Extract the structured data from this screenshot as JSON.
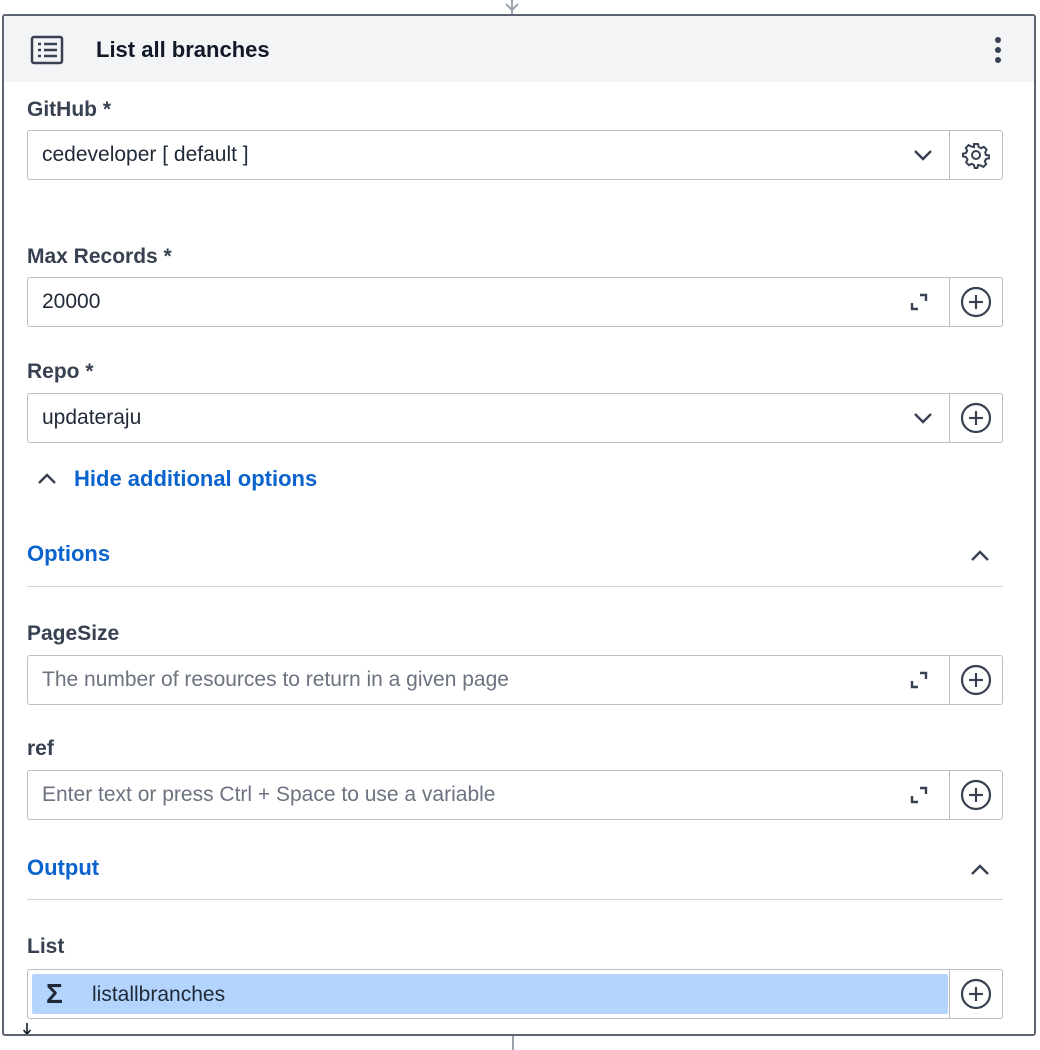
{
  "header": {
    "title": "List all branches",
    "icon": "list-icon",
    "menu_icon": "kebab-menu-icon"
  },
  "github": {
    "label": "GitHub *",
    "value": "cedeveloper [ default ]",
    "action_icon": "gear-icon"
  },
  "max_records": {
    "label": "Max Records *",
    "value": "20000",
    "action_icon": "plus-circle-icon"
  },
  "repo": {
    "label": "Repo *",
    "value": "updateraju",
    "action_icon": "plus-circle-icon"
  },
  "toggle": {
    "label": "Hide additional options"
  },
  "options_section": {
    "title": "Options"
  },
  "page_size": {
    "label": "PageSize",
    "placeholder": "The number of resources to return in a given page"
  },
  "ref": {
    "label": "ref",
    "placeholder": "Enter text or press Ctrl + Space to use a variable"
  },
  "output_section": {
    "title": "Output"
  },
  "list": {
    "label": "List",
    "value": "listallbranches",
    "symbol": "Σ"
  },
  "colors": {
    "accent": "#0b63ce",
    "pill": "#b3d4fc",
    "border": "#5b6470",
    "header_bg": "#f3f4f6"
  }
}
